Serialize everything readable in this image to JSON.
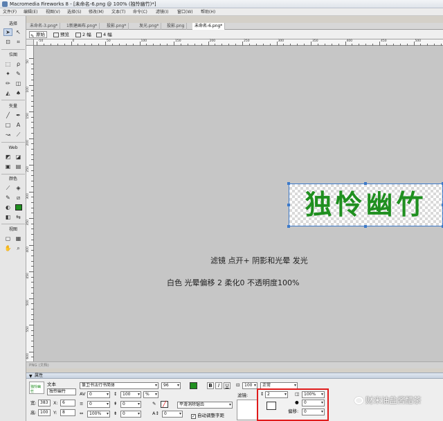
{
  "window": {
    "title": "Macromedia Fireworks 8 - [未命名-6.png @ 100% (独怜幽竹)*]"
  },
  "menubar": {
    "items": [
      "文件(F)",
      "编辑(E)",
      "视图(V)",
      "选择(S)",
      "修改(M)",
      "文本(T)",
      "命令(C)",
      "滤镜(I)",
      "窗口(W)",
      "帮助(H)"
    ]
  },
  "toolbox": {
    "sections": [
      "选择",
      "位图",
      "矢量",
      "Web",
      "颜色",
      "视图"
    ]
  },
  "document_tabs": [
    "未命名-3.png*",
    "1新建画布.png*",
    "投影.png*",
    "发光.png*",
    "投影.png",
    "未命名-6.png*"
  ],
  "active_tab_index": 5,
  "view_bar": {
    "buttons": [
      "原始",
      "预览",
      "2 幅",
      "4 幅"
    ],
    "active_index": 0
  },
  "ruler": {
    "h_labels": [
      "-50",
      "0",
      "50",
      "100",
      "150",
      "200",
      "250",
      "300",
      "350",
      "400",
      "450",
      "500",
      "550"
    ],
    "v_labels": [
      "50",
      "100",
      "150",
      "200",
      "250",
      "300",
      "350",
      "400",
      "450",
      "500",
      "550",
      "600"
    ]
  },
  "canvas": {
    "art_text": "独怜幽竹",
    "art_color": "#1f8f1f",
    "note_line1": "滤镜  点开+  阴影和光晕  发光",
    "note_line2": "白色  光晕偏移  2          柔化0  不透明度100%"
  },
  "status": {
    "text": "PNG (文档)"
  },
  "properties_panel": {
    "header": "属性",
    "object_type": "文本",
    "object_name": "独怜幽竹",
    "thumb_text": "独怜幽竹",
    "font_family": "篆卫书法行书简体",
    "font_size": "96",
    "fill_color": "#1f8f1f",
    "bold": "B",
    "italic": "I",
    "underline": "U",
    "opacity": "100",
    "blend_mode": "正常",
    "kerning": "0",
    "leading": "100",
    "leading_unit": "%",
    "width_label": "宽:",
    "width": "383",
    "height_label": "高:",
    "height": "100",
    "x_label": "X:",
    "x": "6",
    "y_label": "Y:",
    "y": "8",
    "indent": "0",
    "space_before": "0",
    "horizontal_scale": "100%",
    "space_after": "0",
    "baseline_shift": "0",
    "antialias": "平滑消除锯齿",
    "auto_kern_label": "自动调整字距",
    "auto_kern_checked": true,
    "filters_label": "滤镜:",
    "glow_width": "2",
    "glow_opacity": "100%",
    "glow_softness": "0",
    "glow_offset_label": "偏移:",
    "glow_offset": "0",
    "glow_color": "#ffffff"
  },
  "watermark": {
    "text": "财米油盐酱醋茶"
  },
  "colors": {
    "selection": "#3b79c9",
    "highlight": "#e01b1b"
  }
}
